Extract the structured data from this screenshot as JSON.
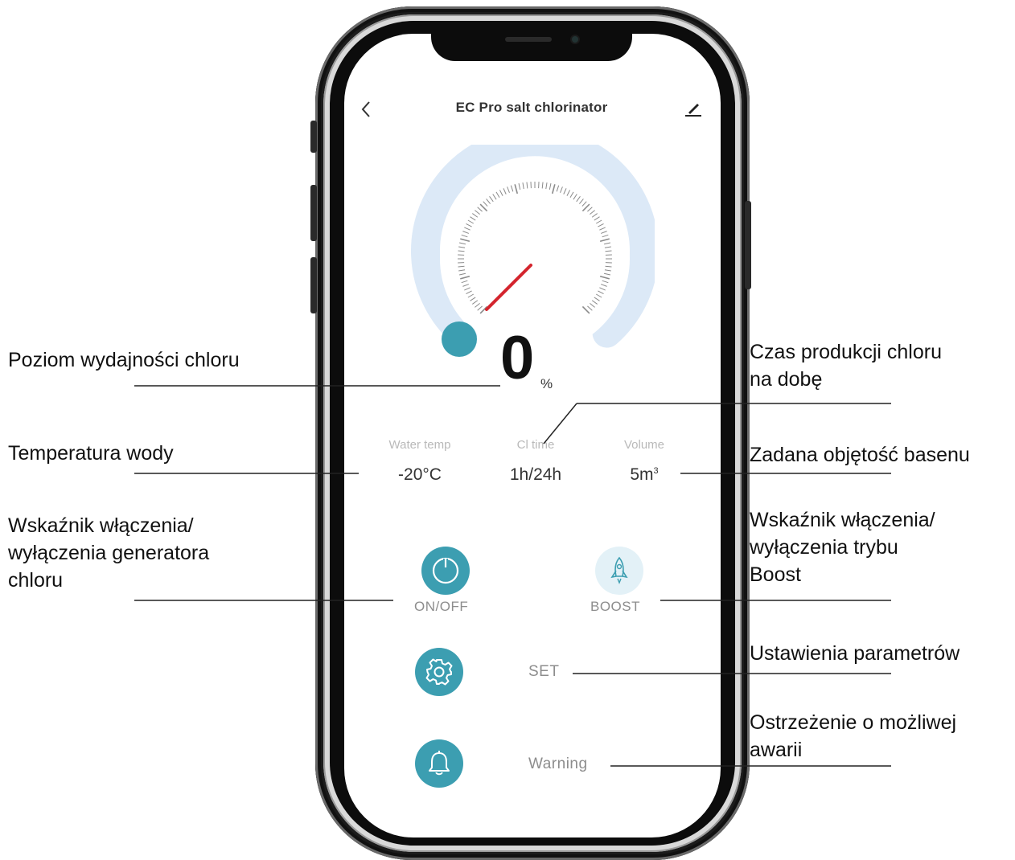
{
  "app": {
    "title": "EC Pro salt chlorinator",
    "back_icon": "chevron-left-icon",
    "edit_icon": "pencil-icon"
  },
  "gauge": {
    "value": "0",
    "unit": "%",
    "level_fraction": 0,
    "colors": {
      "ring": "#dce9f7",
      "knob": "#3c9eb1",
      "needle": "#d4252e",
      "ticks": "#8a8a8a"
    }
  },
  "stats": {
    "water_temp": {
      "label": "Water temp",
      "value": "-20°C"
    },
    "cl_time": {
      "label": "Cl time",
      "value": "1h/24h"
    },
    "volume": {
      "label": "Volume",
      "value": "5m",
      "unit_sup": "3"
    }
  },
  "controls": {
    "onoff": {
      "label": "ON/OFF",
      "icon": "power-icon"
    },
    "boost": {
      "label": "BOOST",
      "icon": "rocket-icon"
    },
    "set": {
      "label": "SET",
      "icon": "gear-icon"
    },
    "warning": {
      "label": "Warning",
      "icon": "bell-icon"
    }
  },
  "annotations": {
    "chlorine_level": "Poziom wydajności chloru",
    "water_temp_line1": "Temperatura wody",
    "onoff_line1": "Wskaźnik włączenia/",
    "onoff_line2": "wyłączenia generatora",
    "onoff_line3": "chloru",
    "cl_time_line1": "Czas produkcji chloru",
    "cl_time_line2": "na dobę",
    "volume_line1": "Zadana objętość basenu",
    "boost_line1": "Wskaźnik włączenia/",
    "boost_line2": "wyłączenia trybu",
    "boost_line3": "Boost",
    "set_line1": "Ustawienia parametrów",
    "warning_line1": "Ostrzeżenie o możliwej",
    "warning_line2": "awarii"
  },
  "colors": {
    "accent": "#3c9eb1",
    "accent_light": "#e3f1f7",
    "phone_frame": "#1c1c1c"
  }
}
